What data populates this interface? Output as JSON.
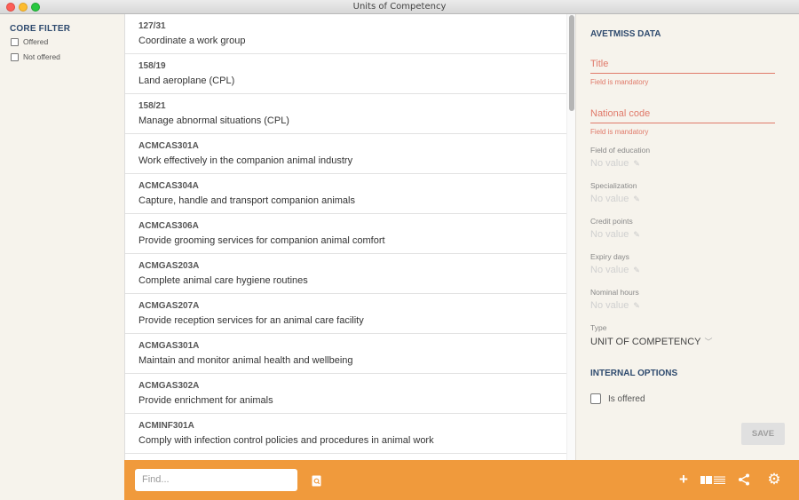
{
  "window": {
    "title": "Units of Competency"
  },
  "sidebar": {
    "heading": "CORE FILTER",
    "filters": [
      {
        "label": "Offered"
      },
      {
        "label": "Not offered"
      }
    ]
  },
  "list": {
    "rows": [
      {
        "code": "127/31",
        "name": "Coordinate a work group"
      },
      {
        "code": "158/19",
        "name": "Land aeroplane (CPL)"
      },
      {
        "code": "158/21",
        "name": "Manage abnormal situations (CPL)"
      },
      {
        "code": "ACMCAS301A",
        "name": "Work effectively in the companion animal industry"
      },
      {
        "code": "ACMCAS304A",
        "name": "Capture, handle and transport companion animals"
      },
      {
        "code": "ACMCAS306A",
        "name": "Provide grooming services for companion animal comfort"
      },
      {
        "code": "ACMGAS203A",
        "name": "Complete animal care hygiene routines"
      },
      {
        "code": "ACMGAS207A",
        "name": "Provide reception services for an animal care facility"
      },
      {
        "code": "ACMGAS301A",
        "name": "Maintain and monitor animal health and wellbeing"
      },
      {
        "code": "ACMGAS302A",
        "name": "Provide enrichment for animals"
      },
      {
        "code": "ACMINF301A",
        "name": "Comply with infection control policies and procedures in animal work"
      }
    ]
  },
  "panel": {
    "avetmiss_heading": "AVETMISS DATA",
    "title_field": {
      "label": "Title",
      "hint": "Field is mandatory"
    },
    "national_code_field": {
      "label": "National code",
      "hint": "Field is mandatory"
    },
    "fields": [
      {
        "label": "Field of education",
        "value": "No value"
      },
      {
        "label": "Specialization",
        "value": "No value"
      },
      {
        "label": "Credit points",
        "value": "No value"
      },
      {
        "label": "Expiry days",
        "value": "No value"
      },
      {
        "label": "Nominal hours",
        "value": "No value"
      }
    ],
    "type": {
      "label": "Type",
      "value": "UNIT OF COMPETENCY"
    },
    "internal_heading": "INTERNAL OPTIONS",
    "is_offered_label": "Is offered",
    "save_label": "SAVE"
  },
  "bottombar": {
    "find_placeholder": "Find...",
    "icons": [
      "search-doc-icon",
      "plus-icon",
      "column-view-icon",
      "share-icon",
      "gear-icon"
    ]
  },
  "colors": {
    "accent": "#f09a3c",
    "heading": "#2e4a6e",
    "error": "#e07a6a"
  }
}
